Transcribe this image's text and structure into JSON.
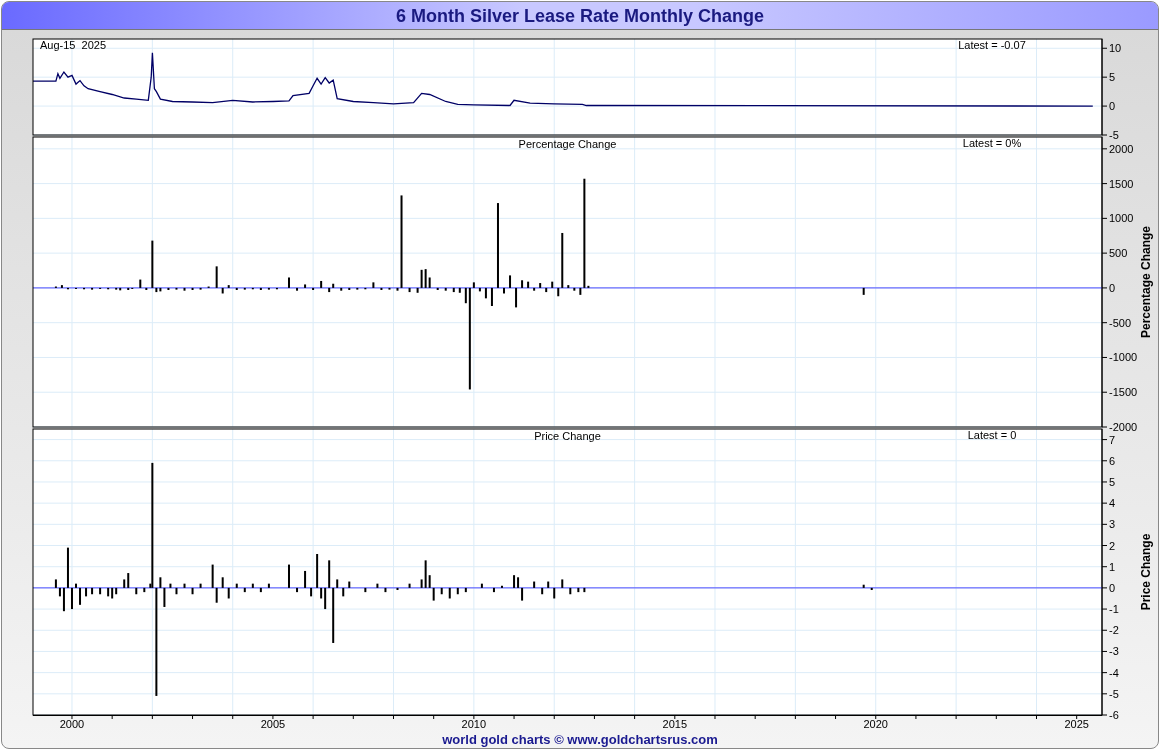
{
  "title": "6 Month Silver Lease Rate Monthly Change",
  "panels": [
    {
      "date": "Aug-15  2025",
      "chart_data": {
        "type": "line",
        "grid": true,
        "x": [
          1999.03,
          1999.6,
          1999.65,
          1999.7,
          1999.8,
          1999.9,
          2000.0,
          2000.1,
          2000.2,
          2000.3,
          2000.4,
          2000.7,
          2001.0,
          2001.3,
          2001.6,
          2001.9,
          2001.97,
          2002.0,
          2002.05,
          2002.1,
          2002.2,
          2002.5,
          2003.0,
          2003.5,
          2004.0,
          2004.5,
          2005.0,
          2005.4,
          2005.5,
          2005.9,
          2006.0,
          2006.1,
          2006.2,
          2006.3,
          2006.4,
          2006.5,
          2006.6,
          2007.0,
          2007.5,
          2008.0,
          2008.5,
          2008.7,
          2008.9,
          2009.3,
          2009.6,
          2010.0,
          2010.9,
          2011.0,
          2011.4,
          2012.0,
          2012.7,
          2012.8,
          2025.4
        ],
        "series": [
          {
            "color": "#000066",
            "values": [
              4.3,
              4.3,
              5.6,
              4.8,
              5.9,
              5.0,
              5.3,
              3.8,
              4.4,
              3.5,
              3.0,
              2.5,
              2.0,
              1.4,
              1.2,
              1.0,
              5.0,
              9.2,
              3.0,
              2.5,
              1.2,
              0.8,
              0.7,
              0.6,
              1.0,
              0.7,
              0.8,
              0.9,
              1.8,
              2.2,
              3.5,
              4.8,
              3.8,
              4.9,
              4.0,
              4.5,
              1.3,
              0.8,
              0.6,
              0.4,
              0.6,
              2.2,
              2.0,
              0.8,
              0.3,
              0.2,
              0.1,
              1.0,
              0.5,
              0.4,
              0.3,
              0.1,
              0.0
            ]
          }
        ],
        "xlim": [
          1999.03,
          2025.63
        ],
        "ylim": [
          -5,
          11.6
        ],
        "yticks": [
          10,
          5,
          0,
          -5
        ],
        "annotations": [
          "Latest = -0.07"
        ]
      }
    },
    {
      "chart_data": {
        "type": "bar",
        "grid": true,
        "ref_lines": [
          {
            "axis": "y",
            "value": 0,
            "color": "#4a4aff"
          }
        ],
        "title": "Percentage Change",
        "ylabel": "Percentage Change",
        "x": [
          1999.6,
          1999.75,
          1999.9,
          2000.1,
          2000.3,
          2000.5,
          2000.7,
          2000.9,
          2001.1,
          2001.2,
          2001.4,
          2001.5,
          2001.7,
          2001.85,
          2002.0,
          2002.1,
          2002.2,
          2002.4,
          2002.6,
          2002.8,
          2003.0,
          2003.2,
          2003.4,
          2003.6,
          2003.75,
          2003.9,
          2004.1,
          2004.3,
          2004.5,
          2004.7,
          2004.9,
          2005.1,
          2005.4,
          2005.6,
          2005.8,
          2006.0,
          2006.2,
          2006.4,
          2006.5,
          2006.7,
          2006.9,
          2007.1,
          2007.3,
          2007.5,
          2007.7,
          2007.9,
          2008.1,
          2008.2,
          2008.4,
          2008.6,
          2008.7,
          2008.8,
          2008.9,
          2009.1,
          2009.3,
          2009.5,
          2009.65,
          2009.8,
          2009.9,
          2010.0,
          2010.15,
          2010.3,
          2010.45,
          2010.6,
          2010.75,
          2010.9,
          2011.05,
          2011.2,
          2011.35,
          2011.5,
          2011.65,
          2011.8,
          2011.95,
          2012.1,
          2012.2,
          2012.35,
          2012.5,
          2012.65,
          2012.75,
          2012.85,
          2019.7
        ],
        "values": [
          20,
          40,
          -20,
          -15,
          -20,
          -25,
          -15,
          -20,
          -25,
          -35,
          -30,
          -15,
          120,
          -30,
          680,
          -60,
          -50,
          -30,
          -25,
          -40,
          -30,
          -25,
          20,
          310,
          -80,
          40,
          -30,
          -25,
          -20,
          -30,
          -25,
          -20,
          150,
          -40,
          50,
          -30,
          100,
          -60,
          60,
          -40,
          -30,
          -25,
          -20,
          80,
          -30,
          -25,
          -40,
          1330,
          -60,
          -70,
          260,
          270,
          150,
          -30,
          -40,
          -60,
          -70,
          -220,
          -1460,
          80,
          -50,
          -150,
          -260,
          1220,
          -80,
          180,
          -280,
          110,
          90,
          -40,
          70,
          -60,
          90,
          -120,
          790,
          40,
          -40,
          -100,
          1570,
          30,
          -100
        ],
        "xlim": [
          1999.03,
          2025.63
        ],
        "ylim": [
          -2000,
          2170
        ],
        "yticks": [
          2000,
          1500,
          1000,
          500,
          0,
          -500,
          -1000,
          -1500,
          -2000
        ],
        "annotations": [
          "Latest = 0%"
        ]
      }
    },
    {
      "chart_data": {
        "type": "bar",
        "grid": true,
        "ref_lines": [
          {
            "axis": "y",
            "value": 0,
            "color": "#4a4aff"
          }
        ],
        "title": "Price Change",
        "ylabel": "Price Change",
        "x": [
          1999.6,
          1999.7,
          1999.8,
          1999.9,
          2000.0,
          2000.1,
          2000.2,
          2000.35,
          2000.5,
          2000.7,
          2000.9,
          2001.0,
          2001.1,
          2001.3,
          2001.4,
          2001.6,
          2001.8,
          2001.95,
          2002.0,
          2002.1,
          2002.2,
          2002.3,
          2002.45,
          2002.6,
          2002.8,
          2003.0,
          2003.2,
          2003.5,
          2003.6,
          2003.75,
          2003.9,
          2004.1,
          2004.3,
          2004.5,
          2004.7,
          2004.9,
          2005.4,
          2005.6,
          2005.8,
          2005.95,
          2006.1,
          2006.2,
          2006.3,
          2006.4,
          2006.5,
          2006.6,
          2006.75,
          2006.9,
          2007.3,
          2007.6,
          2007.8,
          2008.1,
          2008.4,
          2008.7,
          2008.8,
          2008.9,
          2009.0,
          2009.2,
          2009.4,
          2009.6,
          2009.8,
          2010.2,
          2010.5,
          2010.7,
          2011.0,
          2011.1,
          2011.2,
          2011.5,
          2011.7,
          2011.85,
          2012.0,
          2012.2,
          2012.4,
          2012.6,
          2012.75,
          2019.7,
          2019.9
        ],
        "values": [
          0.4,
          -0.4,
          -1.1,
          1.9,
          -1.0,
          0.2,
          -0.8,
          -0.4,
          -0.3,
          -0.3,
          -0.4,
          -0.5,
          -0.3,
          0.4,
          0.7,
          -0.3,
          -0.2,
          0.2,
          5.9,
          -5.1,
          0.5,
          -0.9,
          0.2,
          -0.3,
          0.2,
          -0.3,
          0.2,
          1.1,
          -0.7,
          0.5,
          -0.5,
          0.2,
          -0.2,
          0.2,
          -0.2,
          0.2,
          1.1,
          -0.2,
          0.8,
          -0.4,
          1.6,
          -0.5,
          -1.0,
          1.3,
          -2.6,
          0.4,
          -0.4,
          0.3,
          -0.2,
          0.2,
          -0.2,
          -0.1,
          0.2,
          0.4,
          1.3,
          0.6,
          -0.6,
          -0.3,
          -0.5,
          -0.3,
          -0.2,
          0.2,
          -0.2,
          0.1,
          0.6,
          0.5,
          -0.6,
          0.3,
          -0.3,
          0.3,
          -0.5,
          0.4,
          -0.3,
          -0.2,
          -0.2,
          0.15,
          -0.1
        ],
        "xlim": [
          1999.03,
          2025.63
        ],
        "ylim": [
          -6,
          7.5
        ],
        "yticks": [
          7,
          6,
          5,
          4,
          3,
          2,
          1,
          0,
          -1,
          -2,
          -3,
          -4,
          -5,
          -6
        ],
        "xticks": [
          {
            "value": 2000,
            "label": "2000"
          },
          {
            "value": 2005,
            "label": "2005"
          },
          {
            "value": 2010,
            "label": "2010"
          },
          {
            "value": 2015,
            "label": "2015"
          },
          {
            "value": 2020,
            "label": "2020"
          },
          {
            "value": 2025,
            "label": "2025"
          }
        ],
        "annotations": [
          "Latest = 0"
        ]
      }
    }
  ],
  "footer": "world gold charts © www.goldchartsrus.com"
}
